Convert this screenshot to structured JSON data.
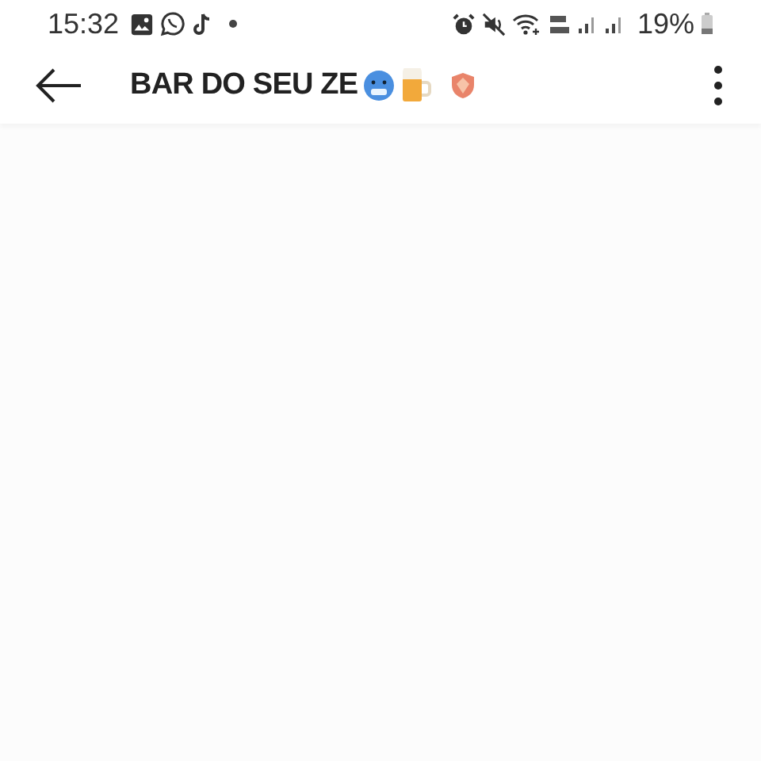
{
  "status_bar": {
    "time": "15:32",
    "battery_percent": "19%"
  },
  "header": {
    "title": "BAR DO SEU ZE"
  }
}
